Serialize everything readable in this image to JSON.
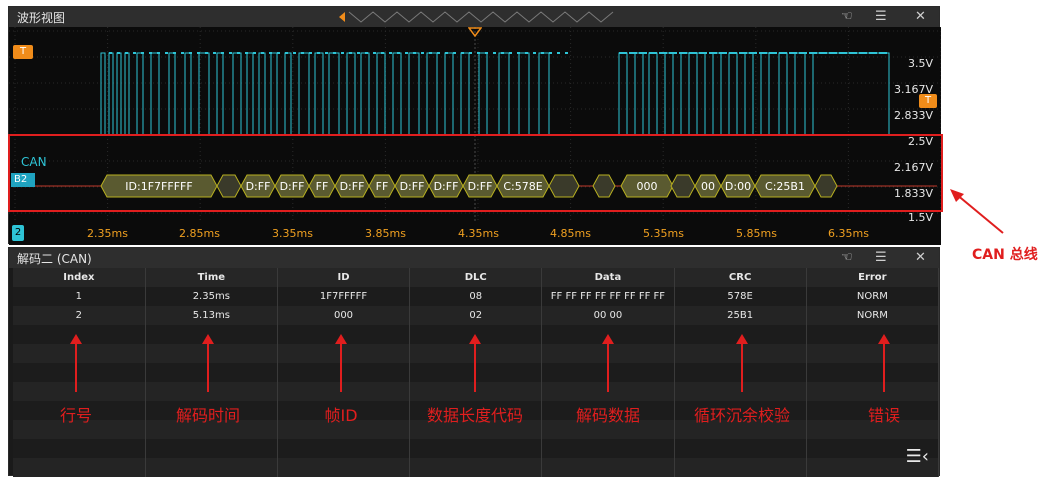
{
  "waveform": {
    "title": "波形视图",
    "trigger_label": "T",
    "channel_label": "CAN",
    "bus_label": "B2",
    "bottom_marker": "2",
    "voltage_labels": [
      "3.5V",
      "3.167V",
      "2.833V",
      "2.5V",
      "2.167V",
      "1.833V",
      "1.5V"
    ],
    "time_labels": [
      "2.35ms",
      "2.85ms",
      "3.35ms",
      "3.85ms",
      "4.35ms",
      "4.85ms",
      "5.35ms",
      "5.85ms",
      "6.35ms"
    ],
    "packets": [
      "ID:1F7FFFFF",
      "D:FF",
      "D:FF",
      "FF",
      "D:FF",
      "FF",
      "D:FF",
      "D:FF",
      "D:FF",
      "C:578E",
      "000",
      "00",
      "D:00",
      "C:25B1"
    ],
    "colors": {
      "signal": "#2ec4d6",
      "trigger": "#f08c1a",
      "packet_border": "#b8b020",
      "packet_fill": "#5a5a30",
      "bus": "#d8d8d8",
      "bus_marker": "#1fa3c0"
    }
  },
  "decode": {
    "title": "解码二 (CAN)",
    "columns": [
      "Index",
      "Time",
      "ID",
      "DLC",
      "Data",
      "CRC",
      "Error"
    ],
    "rows": [
      [
        "1",
        "2.35ms",
        "1F7FFFFF",
        "08",
        "FF FF FF FF FF FF FF FF",
        "578E",
        "NORM"
      ],
      [
        "2",
        "5.13ms",
        "000",
        "02",
        "00 00",
        "25B1",
        "NORM"
      ]
    ]
  },
  "icons": {
    "touch": "touch-icon",
    "menu": "menu-icon",
    "close": "close-icon"
  },
  "annotations": {
    "labels": [
      "行号",
      "解码时间",
      "帧ID",
      "数据长度代码",
      "解码数据",
      "循环沉余校验",
      "错误"
    ],
    "can_bus": "CAN 总线",
    "color": "#e01e1e"
  }
}
